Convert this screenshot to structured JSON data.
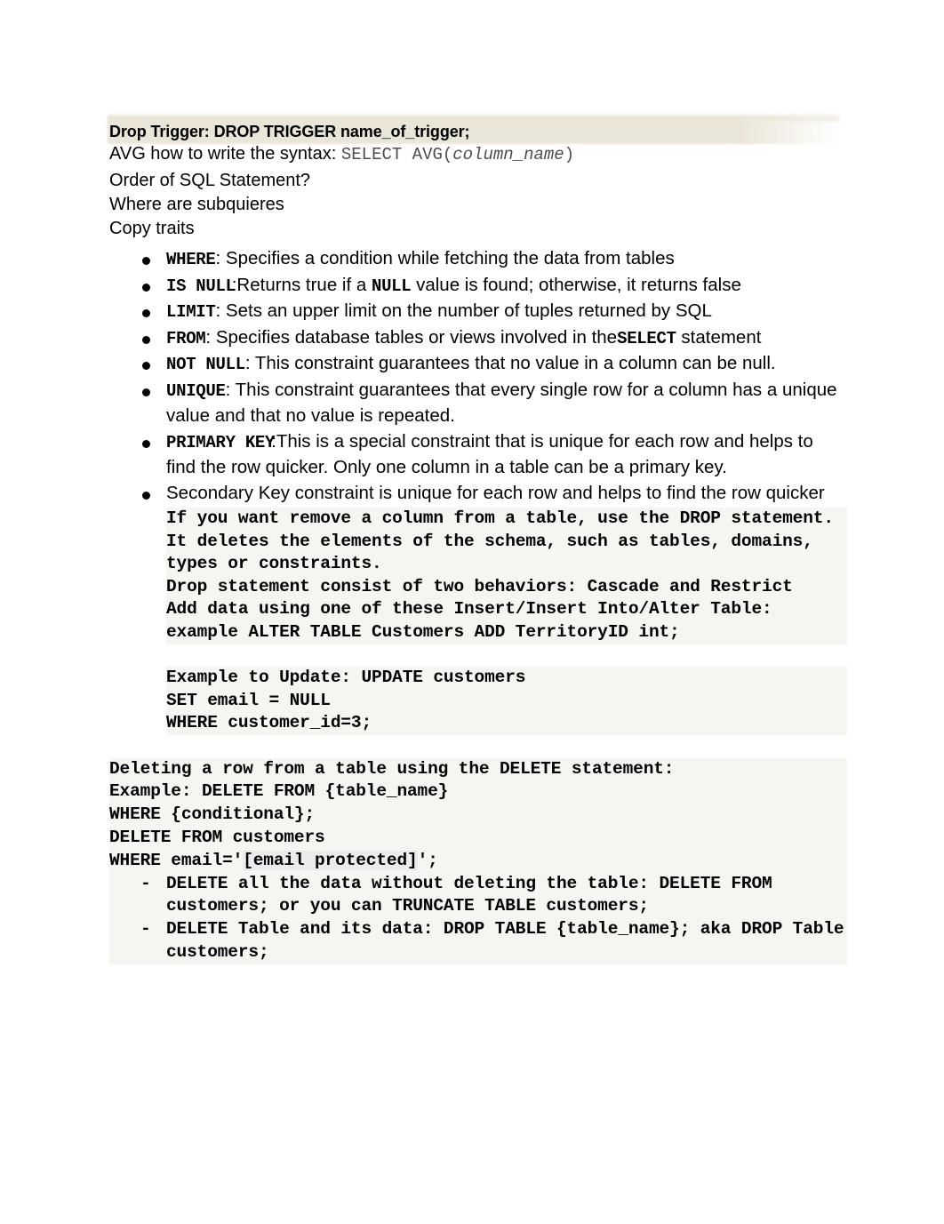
{
  "document": {
    "title": "SQL Notes",
    "highlight_color": "#e8e4d8",
    "text_color": "#000000",
    "muted_text_color": "#4d4d4d",
    "background_color": "#ffffff"
  },
  "header": {
    "drop_trigger_label": "Drop Trigger: DROP TRIGGER name_of_trigger;",
    "avg_prefix": "AVG how to write the syntax: ",
    "avg_code": "SELECT AVG(",
    "avg_code_param": "column_name",
    "avg_code_close": ")"
  },
  "questions": [
    "Order of SQL Statement?",
    "Where are subquieres",
    "Copy traits"
  ],
  "traits": [
    {
      "keyword": "WHERE",
      "separator": ": ",
      "text": "Specifies a condition while fetching the data from tables"
    },
    {
      "keyword": "IS NULL",
      "separator": ":",
      "text": "Returns true if a ",
      "inline_keyword": "NULL",
      "text_after": " value is found; otherwise, it returns false"
    },
    {
      "keyword": "LIMIT",
      "separator": ": ",
      "text": "Sets an upper limit on the number of tuples returned by SQL"
    },
    {
      "keyword": "FROM",
      "separator": ": ",
      "text": "Specifies database tables or views involved in the",
      "inline_keyword": "SELECT",
      "text_after": " statement"
    },
    {
      "keyword": "NOT NULL",
      "separator": ": ",
      "text": "This constraint guarantees that no value in a column can be null."
    },
    {
      "keyword": "UNIQUE",
      "separator": ": ",
      "text": "This constraint guarantees that every single row for a column has a unique value and that no value is repeated."
    },
    {
      "keyword": "PRIMARY KEY",
      "separator": ":",
      "text": "This is a special constraint that is unique for each row and helps to find the row quicker. Only one column in a table can be a primary key."
    },
    {
      "keyword": "",
      "separator": "",
      "text": "Secondary Key constraint is unique for each row and helps to find the row quicker"
    }
  ],
  "drop_block": {
    "paragraph": "If you want remove a column from a table, use the DROP statement. It deletes the elements of the schema, such as tables, domains, types or constraints.",
    "behaviors": "Drop statement consist of two behaviors: Cascade and Restrict",
    "add_data": "Add data using one of these Insert/Insert Into/Alter Table: example ALTER TABLE Customers ADD TerritoryID int;"
  },
  "update_example": {
    "line1": "Example to Update: UPDATE customers",
    "line2": "SET email = NULL",
    "line3": "WHERE customer_id=3;"
  },
  "delete_section": {
    "intro": "Deleting a row from a table using the DELETE statement:",
    "example": "Example: DELETE FROM {table_name}",
    "where_conditional": "WHERE {conditional};",
    "delete_from": "DELETE FROM customers",
    "where_email_prefix": "WHERE email='",
    "where_email_redacted": "[email protected]",
    "where_email_suffix": "';",
    "items": [
      "DELETE all the data without deleting the table: DELETE FROM customers; or you can TRUNCATE TABLE customers;",
      "DELETE Table and its data: DROP TABLE {table_name}; aka DROP Table customers;"
    ]
  }
}
